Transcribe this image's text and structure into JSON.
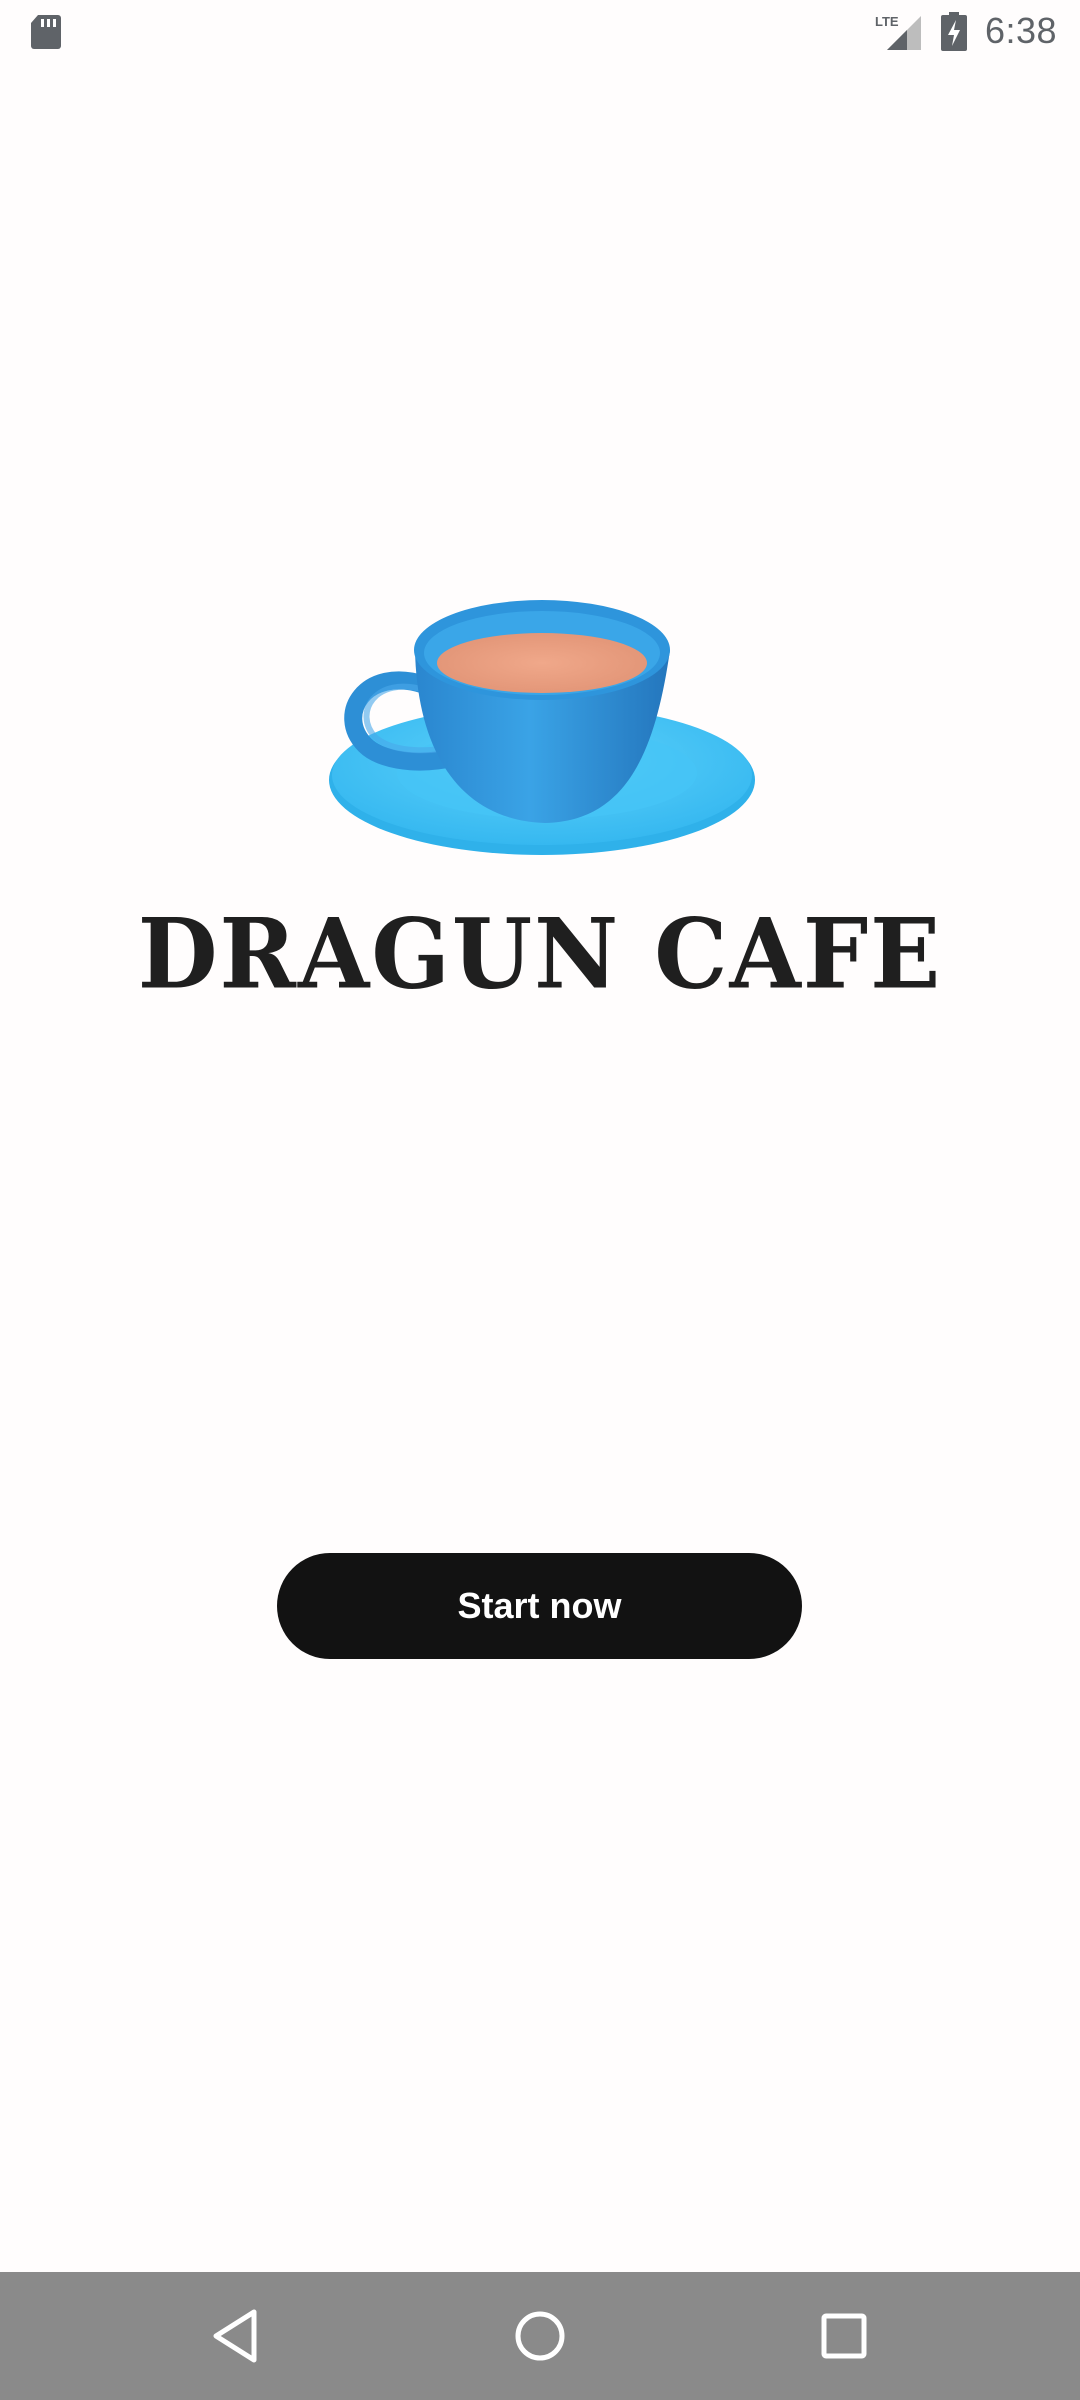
{
  "status_bar": {
    "time": "6:38",
    "network_label": "LTE",
    "icons": [
      "sd-card-icon",
      "lte-signal-icon",
      "battery-charging-icon"
    ]
  },
  "logo": {
    "brand_name": "DRAGUN CAFE",
    "icon": "coffee-cup-icon",
    "colors": {
      "cup": "#2e9ae0",
      "saucer": "#3fc4f7",
      "coffee": "#e89b7e"
    }
  },
  "actions": {
    "start_label": "Start now"
  },
  "nav_bar": {
    "icons": [
      "back-icon",
      "home-icon",
      "recents-icon"
    ]
  }
}
